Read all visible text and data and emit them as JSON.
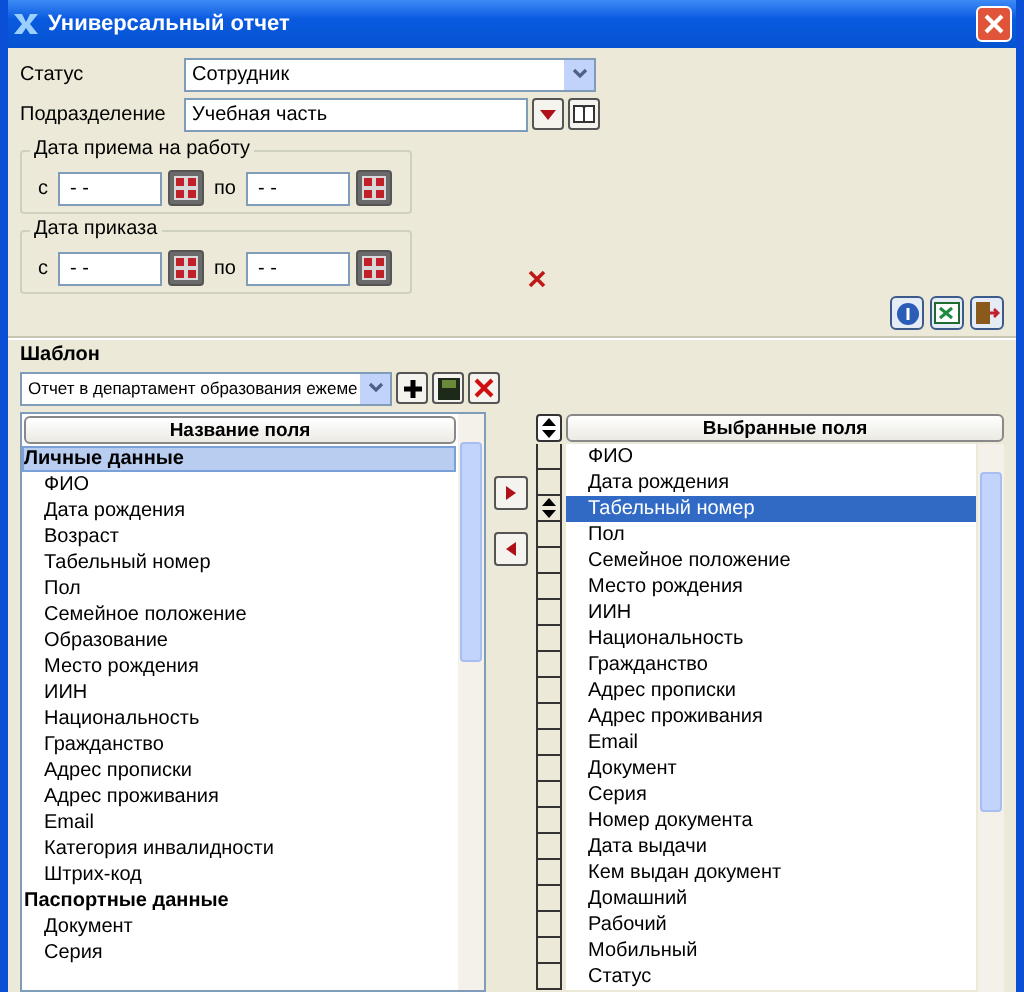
{
  "window": {
    "title": "Универсальный отчет"
  },
  "status": {
    "label": "Статус",
    "value": "Сотрудник"
  },
  "department": {
    "label": "Подразделение",
    "value": "Учебная часть"
  },
  "date_groups": [
    {
      "title": "Дата приема на работу",
      "from_label": "с",
      "from_value": "- -",
      "to_label": "по",
      "to_value": "- -"
    },
    {
      "title": "Дата приказа",
      "from_label": "с",
      "from_value": "- -",
      "to_label": "по",
      "to_value": "- -"
    }
  ],
  "template": {
    "label": "Шаблон",
    "value": "Отчет в департамент образования ежеме"
  },
  "available": {
    "header": "Название поля",
    "items": [
      {
        "text": "Личные данные",
        "kind": "group",
        "selected": true
      },
      {
        "text": "ФИО",
        "kind": "field",
        "selected": false
      },
      {
        "text": "Дата рождения",
        "kind": "field",
        "selected": false
      },
      {
        "text": "Возраст",
        "kind": "field",
        "selected": false
      },
      {
        "text": "Табельный номер",
        "kind": "field",
        "selected": false
      },
      {
        "text": "Пол",
        "kind": "field",
        "selected": false
      },
      {
        "text": "Семейное положение",
        "kind": "field",
        "selected": false
      },
      {
        "text": "Образование",
        "kind": "field",
        "selected": false
      },
      {
        "text": "Место рождения",
        "kind": "field",
        "selected": false
      },
      {
        "text": "ИИН",
        "kind": "field",
        "selected": false
      },
      {
        "text": "Национальность",
        "kind": "field",
        "selected": false
      },
      {
        "text": "Гражданство",
        "kind": "field",
        "selected": false
      },
      {
        "text": "Адрес прописки",
        "kind": "field",
        "selected": false
      },
      {
        "text": "Адрес проживания",
        "kind": "field",
        "selected": false
      },
      {
        "text": "Email",
        "kind": "field",
        "selected": false
      },
      {
        "text": "Категория инвалидности",
        "kind": "field",
        "selected": false
      },
      {
        "text": "Штрих-код",
        "kind": "field",
        "selected": false
      },
      {
        "text": "Паспортные данные",
        "kind": "group",
        "selected": false
      },
      {
        "text": "Документ",
        "kind": "field",
        "selected": false
      },
      {
        "text": "Серия",
        "kind": "field",
        "selected": false
      }
    ]
  },
  "chosen": {
    "header": "Выбранные поля",
    "items": [
      {
        "text": "ФИО",
        "selected": false
      },
      {
        "text": "Дата рождения",
        "selected": false
      },
      {
        "text": "Табельный номер",
        "selected": true
      },
      {
        "text": "Пол",
        "selected": false
      },
      {
        "text": "Семейное положение",
        "selected": false
      },
      {
        "text": "Место рождения",
        "selected": false
      },
      {
        "text": "ИИН",
        "selected": false
      },
      {
        "text": "Национальность",
        "selected": false
      },
      {
        "text": "Гражданство",
        "selected": false
      },
      {
        "text": "Адрес прописки",
        "selected": false
      },
      {
        "text": "Адрес проживания",
        "selected": false
      },
      {
        "text": "Email",
        "selected": false
      },
      {
        "text": "Документ",
        "selected": false
      },
      {
        "text": "Серия",
        "selected": false
      },
      {
        "text": "Номер документа",
        "selected": false
      },
      {
        "text": "Дата выдачи",
        "selected": false
      },
      {
        "text": "Кем выдан документ",
        "selected": false
      },
      {
        "text": "Домашний",
        "selected": false
      },
      {
        "text": "Рабочий",
        "selected": false
      },
      {
        "text": "Мобильный",
        "selected": false
      },
      {
        "text": "Статус",
        "selected": false
      }
    ]
  }
}
